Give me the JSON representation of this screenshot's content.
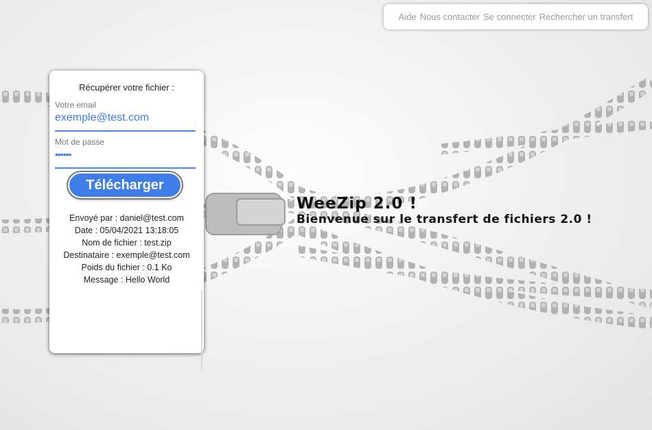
{
  "nav": {
    "items": [
      "Aide",
      "Nous contacter",
      "Se connecter",
      "Rechercher un transfert"
    ]
  },
  "card": {
    "title": "Récupérer votre fichier :",
    "email_label": "Votre email",
    "email_value": "exemple@test.com",
    "password_label": "Mot de passe",
    "password_value": "••••••",
    "download_label": "Télécharger",
    "info": {
      "sender": "Envoyé par : daniel@test.com",
      "date": "Date : 05/04/2021 13:18:05",
      "filename": "Nom de fichier : test.zip",
      "recipient": "Destinataire : exemple@test.com",
      "size": "Poids du fichier : 0.1 Ko",
      "message": "Message : Hello World"
    }
  },
  "hero": {
    "title": "WeeZip 2.0 !",
    "subtitle": "Bienvenue sur le transfert de fichiers 2.0 !"
  },
  "colors": {
    "accent": "#3f7de8",
    "link": "#9a9a9a"
  }
}
